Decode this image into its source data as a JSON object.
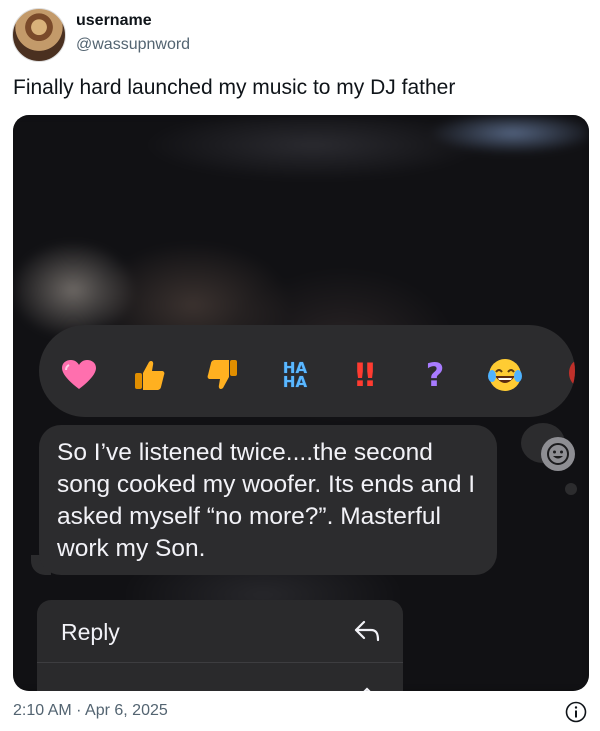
{
  "author": {
    "name": "username",
    "handle": "@wassupnword"
  },
  "post": {
    "text": "Finally hard launched my music to my DJ father"
  },
  "screenshot": {
    "reactions": [
      {
        "icon": "heart-icon",
        "glyph": "❤"
      },
      {
        "icon": "thumbs-up-icon",
        "glyph": "👍"
      },
      {
        "icon": "thumbs-down-icon",
        "glyph": "👎"
      },
      {
        "icon": "haha-icon",
        "glyph": "HA\nHA"
      },
      {
        "icon": "exclamation-icon",
        "glyph": "‼"
      },
      {
        "icon": "question-icon",
        "glyph": "?"
      },
      {
        "icon": "laughing-emoji-icon",
        "glyph": "😂"
      },
      {
        "icon": "balloon-icon",
        "glyph": ""
      }
    ],
    "message": "So I’ve listened twice....the second song cooked my woofer. Its ends and I asked myself “no more?”. Masterful work my Son.",
    "menu": {
      "reply_label": "Reply",
      "second_label": ""
    }
  },
  "footer": {
    "timestamp": "2:10 AM · Apr 6, 2025"
  },
  "colors": {
    "heart": "#ff6fae",
    "thumb": "#ffb020",
    "haha": "#5ab8ff",
    "exclamation": "#ff3b30",
    "question": "#a87bff",
    "bubble": "#2c2c2e",
    "muted_text": "#536471"
  }
}
